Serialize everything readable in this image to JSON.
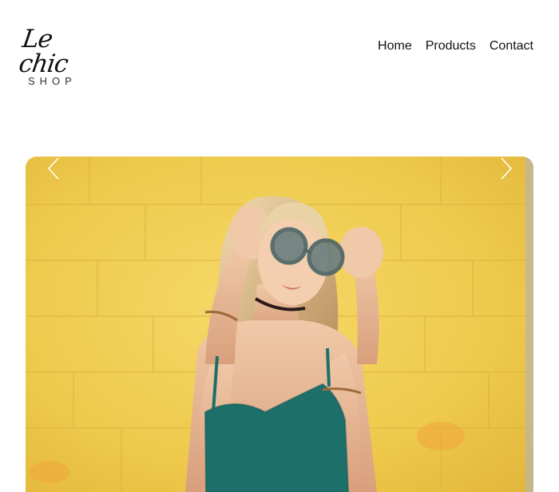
{
  "brand": {
    "script": "Le chic",
    "sub": "SHOP"
  },
  "nav": {
    "items": [
      {
        "label": "Home"
      },
      {
        "label": "Products"
      },
      {
        "label": "Contact"
      }
    ]
  },
  "carousel": {
    "prev_icon": "chevron-left-icon",
    "next_icon": "chevron-right-icon",
    "slide_description_hidden": true
  },
  "colors": {
    "background": "#ffffff",
    "text": "#111111",
    "slide_wall": "#f2cf58",
    "top_color": "#1d6f6a"
  }
}
